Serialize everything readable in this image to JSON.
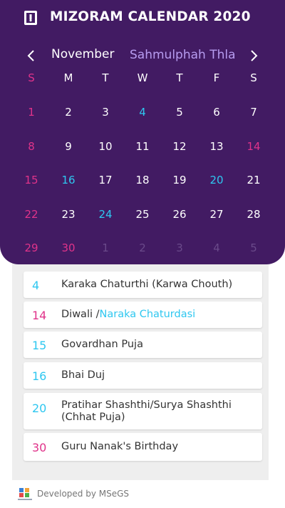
{
  "header": {
    "title": "MIZORAM CALENDAR 2020"
  },
  "month": {
    "english": "November",
    "mizo": "Sahmulphah Thla"
  },
  "weekdays": [
    "S",
    "M",
    "T",
    "W",
    "T",
    "F",
    "S"
  ],
  "calendar": [
    [
      {
        "d": "1",
        "c": "sun"
      },
      {
        "d": "2",
        "c": ""
      },
      {
        "d": "3",
        "c": ""
      },
      {
        "d": "4",
        "c": "hol"
      },
      {
        "d": "5",
        "c": ""
      },
      {
        "d": "6",
        "c": ""
      },
      {
        "d": "7",
        "c": ""
      }
    ],
    [
      {
        "d": "8",
        "c": "sun"
      },
      {
        "d": "9",
        "c": ""
      },
      {
        "d": "10",
        "c": ""
      },
      {
        "d": "11",
        "c": ""
      },
      {
        "d": "12",
        "c": ""
      },
      {
        "d": "13",
        "c": ""
      },
      {
        "d": "14",
        "c": "sun"
      }
    ],
    [
      {
        "d": "15",
        "c": "sun"
      },
      {
        "d": "16",
        "c": "hol"
      },
      {
        "d": "17",
        "c": ""
      },
      {
        "d": "18",
        "c": ""
      },
      {
        "d": "19",
        "c": ""
      },
      {
        "d": "20",
        "c": "hol"
      },
      {
        "d": "21",
        "c": ""
      }
    ],
    [
      {
        "d": "22",
        "c": "sun"
      },
      {
        "d": "23",
        "c": ""
      },
      {
        "d": "24",
        "c": "hol"
      },
      {
        "d": "25",
        "c": ""
      },
      {
        "d": "26",
        "c": ""
      },
      {
        "d": "27",
        "c": ""
      },
      {
        "d": "28",
        "c": ""
      }
    ],
    [
      {
        "d": "29",
        "c": "sun"
      },
      {
        "d": "30",
        "c": "sun"
      },
      {
        "d": "1",
        "c": "dim"
      },
      {
        "d": "2",
        "c": "dim"
      },
      {
        "d": "3",
        "c": "dim"
      },
      {
        "d": "4",
        "c": "dim"
      },
      {
        "d": "5",
        "c": "dim"
      }
    ]
  ],
  "holidays": [
    {
      "day": "4",
      "name": "Karaka Chaturthi (Karwa Chouth)",
      "extra": "",
      "color": "blue"
    },
    {
      "day": "14",
      "name": "Diwali /",
      "extra": "Naraka Chaturdasi",
      "color": "pink"
    },
    {
      "day": "15",
      "name": "Govardhan Puja",
      "extra": "",
      "color": "blue"
    },
    {
      "day": "16",
      "name": "Bhai Duj",
      "extra": "",
      "color": "blue"
    },
    {
      "day": "20",
      "name": "Pratihar Shashthi/Surya Shashthi (Chhat Puja)",
      "extra": "",
      "color": "blue"
    },
    {
      "day": "30",
      "name": "Guru Nanak's Birthday",
      "extra": "",
      "color": "pink"
    }
  ],
  "footer": {
    "developer": "Developed by MSeGS"
  },
  "colors": {
    "header_bg": "#421b63",
    "sunday": "#e0338a",
    "holiday": "#2ec7f0",
    "mizo_month": "#b79cf0",
    "dimmed": "#6a4a8a"
  }
}
